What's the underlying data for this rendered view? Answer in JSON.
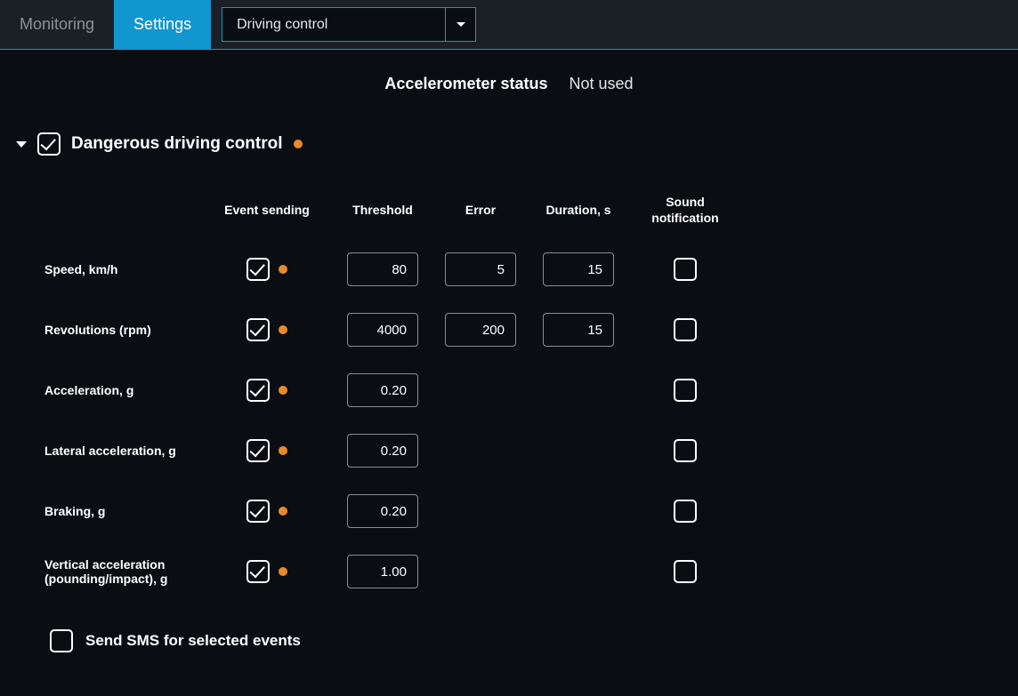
{
  "tabs": {
    "monitoring": "Monitoring",
    "settings": "Settings"
  },
  "dropdown": {
    "label": "Driving control"
  },
  "status": {
    "label": "Accelerometer status",
    "value": "Not used"
  },
  "section": {
    "title": "Dangerous driving control",
    "checked": true
  },
  "columns": {
    "event_sending": "Event sending",
    "threshold": "Threshold",
    "error": "Error",
    "duration": "Duration, s",
    "sound": "Sound notification"
  },
  "rows": [
    {
      "label": "Speed, km/h",
      "event": true,
      "threshold": "80",
      "error": "5",
      "duration": "15",
      "sound": false
    },
    {
      "label": "Revolutions (rpm)",
      "event": true,
      "threshold": "4000",
      "error": "200",
      "duration": "15",
      "sound": false
    },
    {
      "label": "Acceleration, g",
      "event": true,
      "threshold": "0.20",
      "error": null,
      "duration": null,
      "sound": false
    },
    {
      "label": "Lateral acceleration, g",
      "event": true,
      "threshold": "0.20",
      "error": null,
      "duration": null,
      "sound": false
    },
    {
      "label": "Braking, g",
      "event": true,
      "threshold": "0.20",
      "error": null,
      "duration": null,
      "sound": false
    },
    {
      "label": "Vertical acceleration (pounding/impact), g",
      "event": true,
      "threshold": "1.00",
      "error": null,
      "duration": null,
      "sound": false
    }
  ],
  "sms": {
    "label": "Send SMS for selected events",
    "checked": false
  }
}
